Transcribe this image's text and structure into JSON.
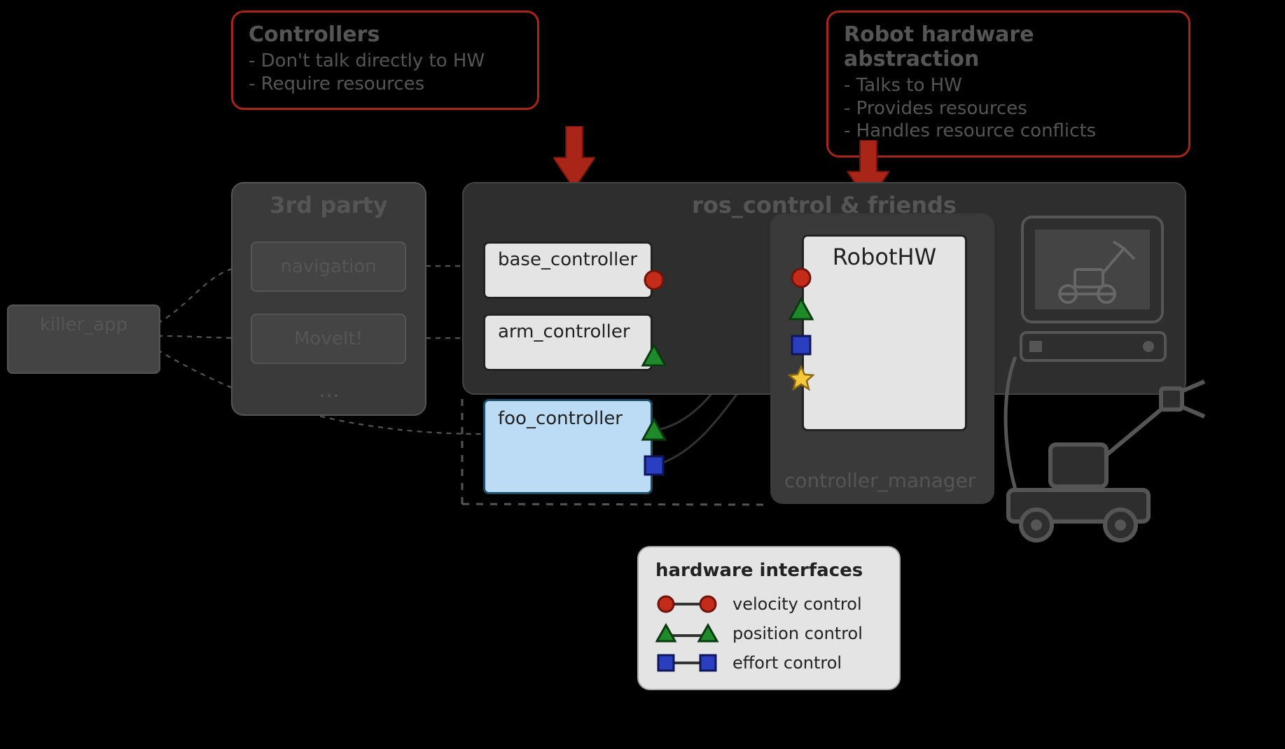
{
  "callouts": {
    "controllers": {
      "title": "Controllers",
      "lines": [
        "- Don't talk directly to HW",
        "- Require resources"
      ]
    },
    "robothw": {
      "title": "Robot hardware abstraction",
      "lines": [
        "- Talks to HW",
        "- Provides resources",
        "- Handles resource conflicts"
      ]
    }
  },
  "panels": {
    "third_party": "3rd party",
    "ros": "ros_control & friends",
    "cm": "controller_manager"
  },
  "nodes": {
    "killer_app": "killer_app",
    "navigation": "navigation",
    "moveit": "MoveIt!",
    "ellipsis": "…",
    "base_controller": "base_controller",
    "arm_controller": "arm_controller",
    "foo_controller": "foo_controller",
    "robot_hw": "RobotHW"
  },
  "legend": {
    "title": "hardware interfaces",
    "velocity": "velocity control",
    "position": "position control",
    "effort": "effort control"
  },
  "colors": {
    "red": "#c52b1a",
    "red_stroke": "#6e140a",
    "green": "#1f8a2a",
    "green_stroke": "#0b3a10",
    "blue": "#2a3fbf",
    "blue_stroke": "#0f165a",
    "yellow": "#f5c83b",
    "yellow_stroke": "#8a6b10",
    "callout_border": "#a82517"
  }
}
